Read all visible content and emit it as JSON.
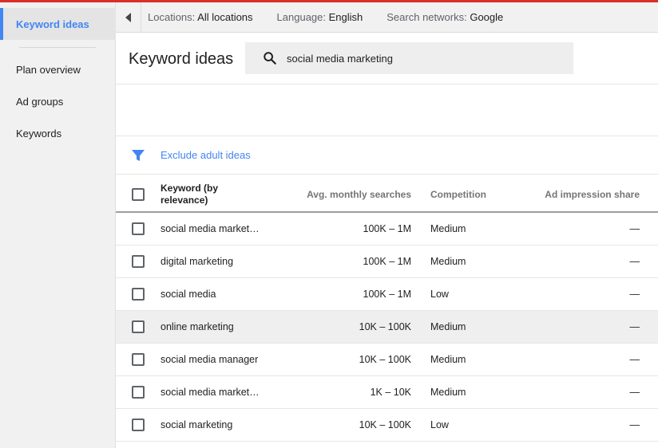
{
  "sidebar": {
    "items": [
      {
        "label": "Keyword ideas",
        "active": true
      },
      {
        "label": "Plan overview"
      },
      {
        "label": "Ad groups"
      },
      {
        "label": "Keywords"
      }
    ]
  },
  "topbar": {
    "filters": [
      {
        "key": "Locations:",
        "value": "All locations"
      },
      {
        "key": "Language:",
        "value": "English"
      },
      {
        "key": "Search networks:",
        "value": "Google"
      }
    ]
  },
  "header": {
    "title": "Keyword ideas",
    "search_value": "social media marketing",
    "search_icon": "search-icon"
  },
  "filterbar": {
    "icon": "funnel-icon",
    "exclude_label": "Exclude adult ideas"
  },
  "table": {
    "columns": {
      "keyword": "Keyword (by relevance)",
      "avg": "Avg. monthly searches",
      "competition": "Competition",
      "impression": "Ad impression share"
    },
    "rows": [
      {
        "keyword": "social media marketi…",
        "avg": "100K – 1M",
        "competition": "Medium",
        "impression": "—"
      },
      {
        "keyword": "digital marketing",
        "avg": "100K – 1M",
        "competition": "Medium",
        "impression": "—"
      },
      {
        "keyword": "social media",
        "avg": "100K – 1M",
        "competition": "Low",
        "impression": "—"
      },
      {
        "keyword": "online marketing",
        "avg": "10K – 100K",
        "competition": "Medium",
        "impression": "—"
      },
      {
        "keyword": "social media manager",
        "avg": "10K – 100K",
        "competition": "Medium",
        "impression": "—"
      },
      {
        "keyword": "social media marketi…",
        "avg": "1K – 10K",
        "competition": "Medium",
        "impression": "—"
      },
      {
        "keyword": "social marketing",
        "avg": "10K – 100K",
        "competition": "Low",
        "impression": "—"
      }
    ]
  },
  "colors": {
    "accent": "#4285f4",
    "top_line": "#d93025"
  }
}
